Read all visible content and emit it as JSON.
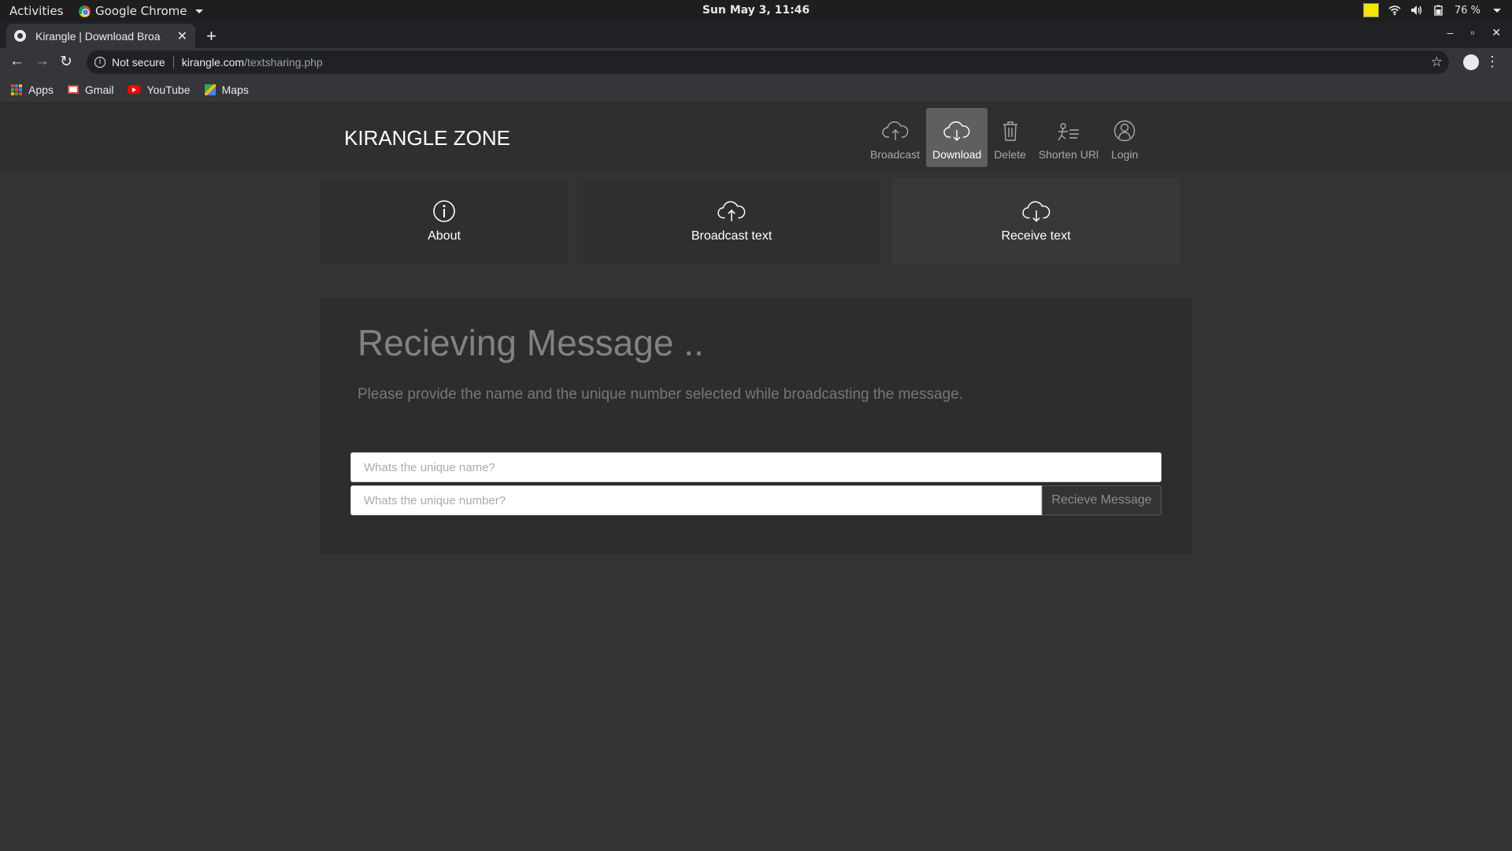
{
  "system_bar": {
    "activities": "Activities",
    "app_name": "Google Chrome",
    "clock": "Sun May  3, 11:46",
    "battery": "76 %"
  },
  "browser": {
    "tab_title": "Kirangle | Download Broa",
    "security": "Not secure",
    "url_host": "kirangle.com",
    "url_path": "/textsharing.php",
    "bookmarks": [
      {
        "label": "Apps",
        "icon": "apps-grid-icon"
      },
      {
        "label": "Gmail",
        "icon": "gmail-icon"
      },
      {
        "label": "YouTube",
        "icon": "youtube-icon"
      },
      {
        "label": "Maps",
        "icon": "maps-icon"
      }
    ]
  },
  "site": {
    "brand": "KIRANGLE ZONE",
    "nav": [
      {
        "label": "Broadcast",
        "icon": "cloud-upload-icon",
        "active": false
      },
      {
        "label": "Download",
        "icon": "cloud-download-icon",
        "active": true
      },
      {
        "label": "Delete",
        "icon": "trash-icon",
        "active": false
      },
      {
        "label": "Shorten URl",
        "icon": "shorten-url-icon",
        "active": false
      },
      {
        "label": "Login",
        "icon": "user-icon",
        "active": false
      }
    ],
    "cards": [
      {
        "label": "About",
        "icon": "info-icon"
      },
      {
        "label": "Broadcast text",
        "icon": "cloud-upload-icon"
      },
      {
        "label": "Receive text",
        "icon": "cloud-download-icon",
        "active": true
      }
    ]
  },
  "panel": {
    "heading": "Recieving Message ..",
    "description": "Please provide the name and the unique number selected while broadcasting the message.",
    "name_placeholder": "Whats the unique name?",
    "number_placeholder": "Whats the unique number?",
    "button": "Recieve Message"
  },
  "colors": {
    "page_bg": "#333333",
    "nav_active_bg": "#5f5f5f",
    "heading": "#828282"
  }
}
